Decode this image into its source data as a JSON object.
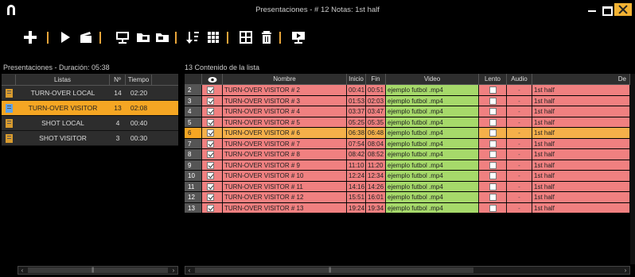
{
  "window": {
    "title": "Presentaciones - # 12 Notas: 1st half"
  },
  "toolbar": {
    "icons": [
      "plus-icon",
      "play-icon",
      "clapperboard-icon",
      "presentation-icon",
      "folder-icon",
      "folder-export-icon",
      "sort-icon",
      "grid-icon",
      "table-icon",
      "trash-icon",
      "present-icon"
    ]
  },
  "left_panel": {
    "label": "Presentaciones - Duración: 05:38",
    "headers": [
      "Listas",
      "Nº",
      "Tiempo"
    ],
    "rows": [
      {
        "name": "TURN-OVER LOCAL",
        "n": "14",
        "time": "02:20",
        "selected": false
      },
      {
        "name": "TURN-OVER VISITOR",
        "n": "13",
        "time": "02:08",
        "selected": true
      },
      {
        "name": "SHOT LOCAL",
        "n": "4",
        "time": "00:40",
        "selected": false
      },
      {
        "name": "SHOT VISITOR",
        "n": "3",
        "time": "00:30",
        "selected": false
      }
    ]
  },
  "right_panel": {
    "label": "13  Contenido de la lista",
    "headers": {
      "eye": "",
      "name": "Nombre",
      "ini": "Inicio",
      "fin": "Fin",
      "video": "Video",
      "lento": "Lento",
      "audio": "Audio",
      "de": "De"
    },
    "rows": [
      {
        "num": "2",
        "name": "TURN-OVER VISITOR # 2",
        "ini": "00:41",
        "fin": "00:51",
        "video": "ejemplo futbol .mp4",
        "audio": "-",
        "de": "1st half",
        "selected": false
      },
      {
        "num": "3",
        "name": "TURN-OVER VISITOR # 3",
        "ini": "01:53",
        "fin": "02:03",
        "video": "ejemplo futbol .mp4",
        "audio": "-",
        "de": "1st half",
        "selected": false
      },
      {
        "num": "4",
        "name": "TURN-OVER VISITOR # 4",
        "ini": "03:37",
        "fin": "03:47",
        "video": "ejemplo futbol .mp4",
        "audio": "-",
        "de": "1st half",
        "selected": false
      },
      {
        "num": "5",
        "name": "TURN-OVER VISITOR # 5",
        "ini": "05:25",
        "fin": "05:35",
        "video": "ejemplo futbol .mp4",
        "audio": "-",
        "de": "1st half",
        "selected": false
      },
      {
        "num": "6",
        "name": "TURN-OVER VISITOR # 6",
        "ini": "06:38",
        "fin": "06:48",
        "video": "ejemplo futbol .mp4",
        "audio": "-",
        "de": "1st half",
        "selected": true
      },
      {
        "num": "7",
        "name": "TURN-OVER VISITOR # 7",
        "ini": "07:54",
        "fin": "08:04",
        "video": "ejemplo futbol .mp4",
        "audio": "-",
        "de": "1st half",
        "selected": false
      },
      {
        "num": "8",
        "name": "TURN-OVER VISITOR # 8",
        "ini": "08:42",
        "fin": "08:52",
        "video": "ejemplo futbol .mp4",
        "audio": "-",
        "de": "1st half",
        "selected": false
      },
      {
        "num": "9",
        "name": "TURN-OVER VISITOR # 9",
        "ini": "11:10",
        "fin": "11:20",
        "video": "ejemplo futbol .mp4",
        "audio": "-",
        "de": "1st half",
        "selected": false
      },
      {
        "num": "10",
        "name": "TURN-OVER VISITOR # 10",
        "ini": "12:24",
        "fin": "12:34",
        "video": "ejemplo futbol .mp4",
        "audio": "-",
        "de": "1st half",
        "selected": false
      },
      {
        "num": "11",
        "name": "TURN-OVER VISITOR # 11",
        "ini": "14:16",
        "fin": "14:26",
        "video": "ejemplo futbol .mp4",
        "audio": "-",
        "de": "1st half",
        "selected": false
      },
      {
        "num": "12",
        "name": "TURN-OVER VISITOR # 12",
        "ini": "15:51",
        "fin": "16:01",
        "video": "ejemplo futbol .mp4",
        "audio": "-",
        "de": "1st half",
        "selected": false
      },
      {
        "num": "13",
        "name": "TURN-OVER VISITOR # 13",
        "ini": "19:24",
        "fin": "19:34",
        "video": "ejemplo futbol .mp4",
        "audio": "-",
        "de": "1st half",
        "selected": false
      }
    ]
  },
  "colors": {
    "accent": "#f5a623",
    "row_red": "#f08080",
    "video_green": "#a6d96a"
  }
}
